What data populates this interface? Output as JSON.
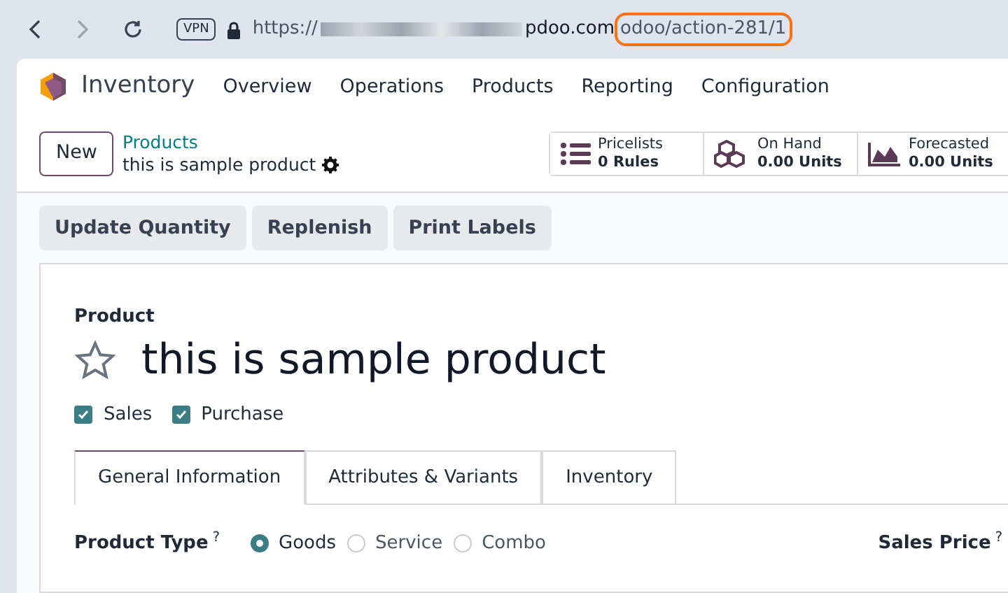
{
  "browser": {
    "url_prefix": "https://",
    "url_host_end": "pdoo.com",
    "url_path": "odoo/action-281/1",
    "vpn_badge": "VPN"
  },
  "navbar": {
    "app_name": "Inventory",
    "menu": [
      "Overview",
      "Operations",
      "Products",
      "Reporting",
      "Configuration"
    ]
  },
  "control_panel": {
    "new_button": "New",
    "breadcrumb": "Products",
    "record_name": "this is sample product",
    "smart_buttons": [
      {
        "kind": "list",
        "label": "Pricelists",
        "value": "0 Rules"
      },
      {
        "kind": "boxes",
        "label": "On Hand",
        "value": "0.00 Units"
      },
      {
        "kind": "chart",
        "label": "Forecasted",
        "value": "0.00 Units"
      }
    ]
  },
  "actions": [
    "Update Quantity",
    "Replenish",
    "Print Labels"
  ],
  "form": {
    "name_label": "Product",
    "name": "this is sample product",
    "favorite": false,
    "flags": [
      {
        "label": "Sales",
        "checked": true
      },
      {
        "label": "Purchase",
        "checked": true
      }
    ],
    "tabs": [
      {
        "label": "General Information",
        "selected": true
      },
      {
        "label": "Attributes & Variants",
        "selected": false
      },
      {
        "label": "Inventory",
        "selected": false
      }
    ],
    "product_type": {
      "label": "Product Type",
      "help": "?",
      "options": [
        {
          "label": "Goods",
          "selected": true
        },
        {
          "label": "Service",
          "selected": false
        },
        {
          "label": "Combo",
          "selected": false
        }
      ]
    },
    "sales_price": {
      "label": "Sales Price",
      "help": "?"
    }
  }
}
